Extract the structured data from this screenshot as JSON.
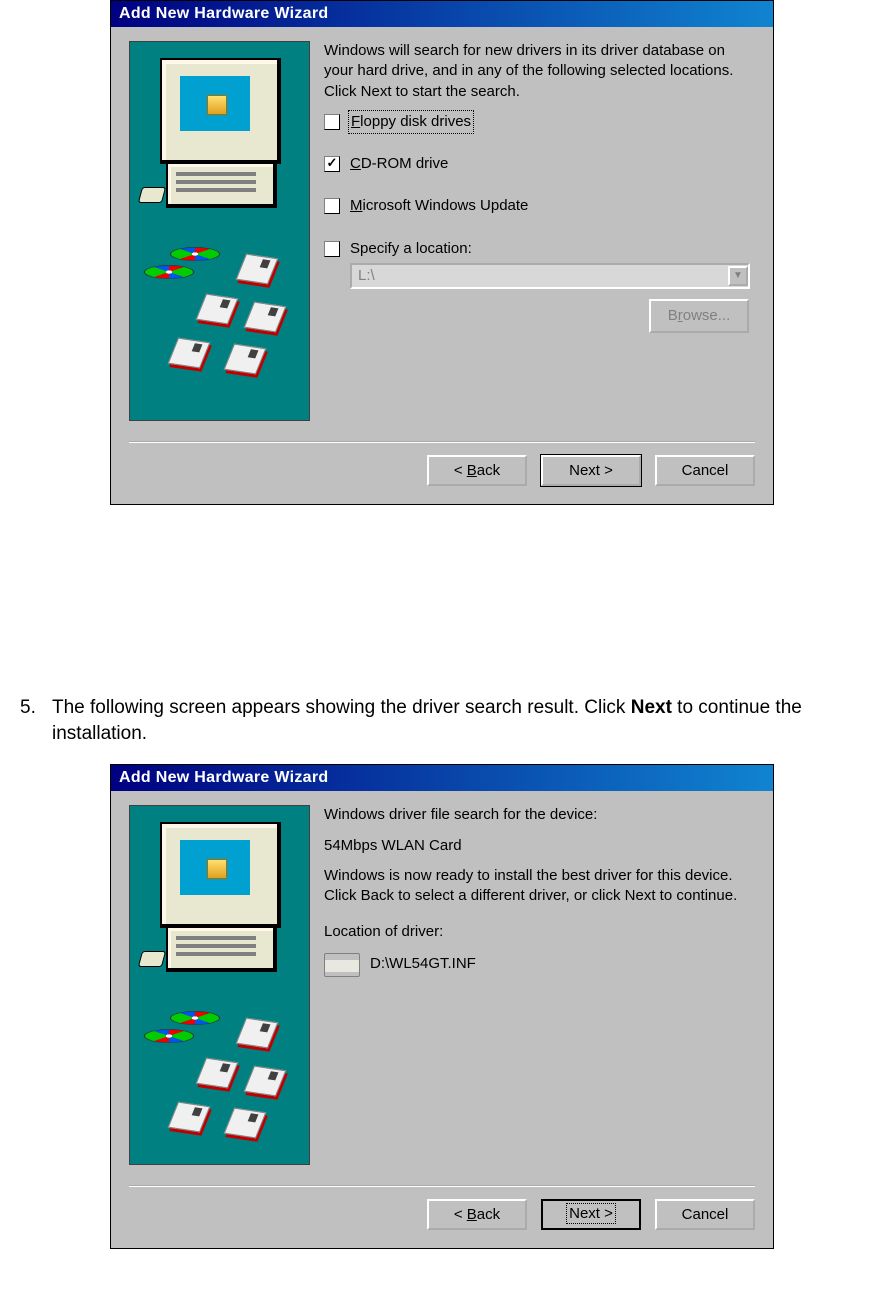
{
  "dialog1": {
    "title": "Add New Hardware Wizard",
    "intro": "Windows will search for new drivers in its driver database on your hard drive, and in any of the following selected locations. Click Next to start the search.",
    "options": {
      "floppy": {
        "label_pre": "F",
        "label_rest": "loppy disk drives",
        "checked": false,
        "focused": true
      },
      "cdrom": {
        "label_pre": "C",
        "label_rest": "D-ROM drive",
        "checked": true
      },
      "wu": {
        "label_pre": "M",
        "label_rest": "icrosoft Windows Update",
        "checked": false
      },
      "specify": {
        "label": "Specify a location:",
        "checked": false,
        "path": "L:\\",
        "browse": "Browse..."
      }
    },
    "buttons": {
      "back": "< Back",
      "next": "Next >",
      "cancel": "Cancel"
    }
  },
  "step5": {
    "num": "5.",
    "text_a": "The following screen appears showing the driver search result. Click ",
    "bold": "Next",
    "text_b": " to continue the installation."
  },
  "dialog2": {
    "title": "Add New Hardware Wizard",
    "line1": "Windows driver file search for the device:",
    "device": "54Mbps WLAN Card",
    "line2": "Windows is now ready to install the best driver for this device. Click Back to select a different driver, or click Next to continue.",
    "loc_label": "Location of driver:",
    "loc_path": "D:\\WL54GT.INF",
    "buttons": {
      "back": "< Back",
      "next": "Next >",
      "cancel": "Cancel"
    }
  }
}
